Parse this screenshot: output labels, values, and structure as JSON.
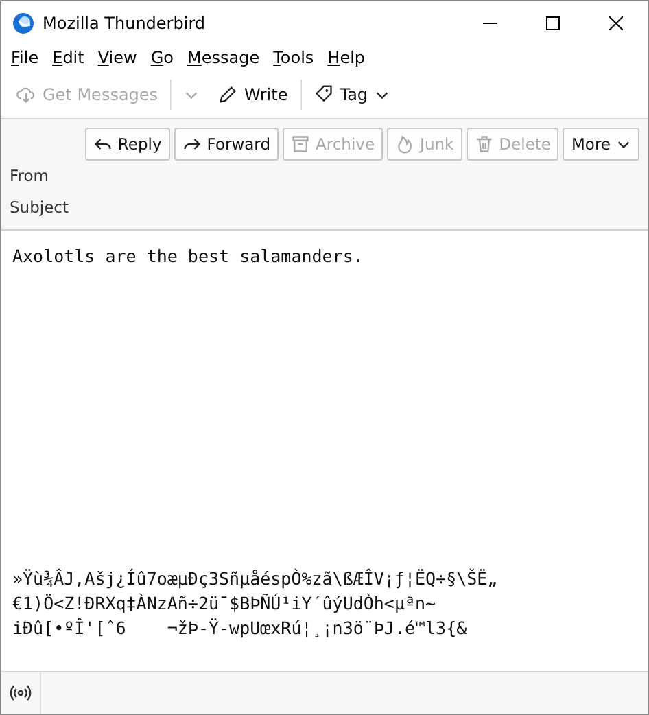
{
  "window": {
    "title": "Mozilla Thunderbird"
  },
  "menu": [
    "File",
    "Edit",
    "View",
    "Go",
    "Message",
    "Tools",
    "Help"
  ],
  "toolbar": [
    {
      "kind": "get",
      "label": "Get Messages",
      "disabled": true
    },
    {
      "kind": "write",
      "label": "Write",
      "disabled": false
    },
    {
      "kind": "tag",
      "label": "Tag",
      "disabled": false
    }
  ],
  "header_buttons": [
    {
      "kind": "reply",
      "label": "Reply",
      "disabled": false
    },
    {
      "kind": "forward",
      "label": "Forward",
      "disabled": false
    },
    {
      "kind": "archive",
      "label": "Archive",
      "disabled": true
    },
    {
      "kind": "junk",
      "label": "Junk",
      "disabled": true
    },
    {
      "kind": "delete",
      "label": "Delete",
      "disabled": true
    },
    {
      "kind": "more",
      "label": "More",
      "disabled": false
    }
  ],
  "header_fields": [
    "From",
    "Subject"
  ],
  "body": {
    "text": "Axolotls are the best salamanders.",
    "garbled_lines": [
      "»Ÿù¾ÂJ,Ašj¿Íû7oæµÐç3SñµåéspÒ%zã\\ßÆÎV¡ƒ¦ËQ÷§\\ŠË„",
      "€1)Ö<Z!ÐRXq‡ÀNzAñ÷2ü¯$BÞÑÚ¹iY´ûýUdÒh<µªn~",
      "iÐû[•ºÎ'[ˆ6    ¬žÞ-Ÿ-wpUœxRú¦¸¡n3ö¨ÞJ.é™l3{&"
    ]
  }
}
